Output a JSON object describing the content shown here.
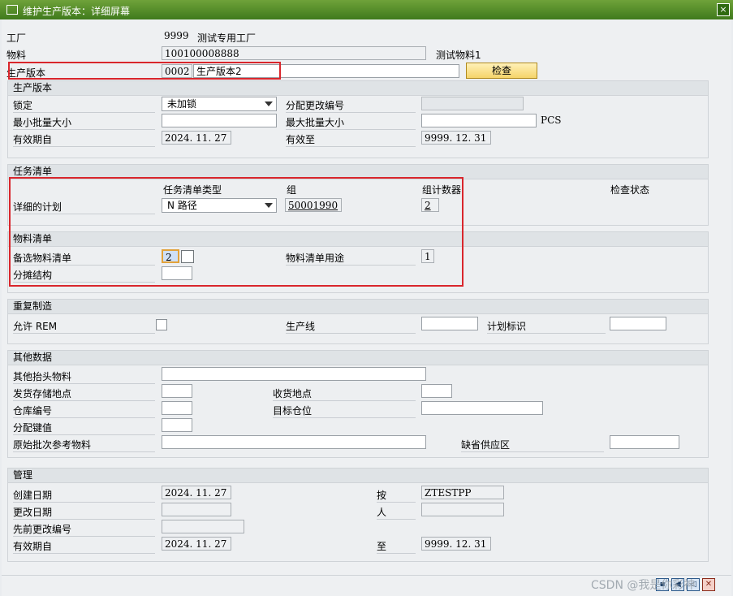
{
  "window": {
    "title": "维护生产版本：详细屏幕",
    "close_glyph": "×"
  },
  "header": {
    "plant_label": "工厂",
    "plant_value": "9999",
    "plant_desc": "测试专用工厂",
    "material_label": "物料",
    "material_value": "100100008888",
    "material_desc": "测试物料1",
    "version_label": "生产版本",
    "version_value": "0002",
    "version_desc": "生产版本2",
    "check_button": "检查"
  },
  "prod_version": {
    "title": "生产版本",
    "lock_label": "锁定",
    "lock_value": "未加锁",
    "change_no_label": "分配更改编号",
    "change_no_value": "",
    "min_lot_label": "最小批量大小",
    "min_lot_value": "",
    "max_lot_label": "最大批量大小",
    "max_lot_value": "",
    "unit": "PCS",
    "valid_from_label": "有效期自",
    "valid_from_value": "2024. 11. 27",
    "valid_to_label": "有效至",
    "valid_to_value": "9999. 12. 31"
  },
  "task_list": {
    "title": "任务清单",
    "col_type": "任务清单类型",
    "col_group": "组",
    "col_counter": "组计数器",
    "col_check": "检查状态",
    "row_label": "详细的计划",
    "type_value": "N 路径",
    "group_value": "50001990",
    "counter_value": "2"
  },
  "bom": {
    "title": "物料清单",
    "alt_label": "备选物料清单",
    "alt_value": "2",
    "usage_label": "物料清单用途",
    "usage_value": "1",
    "apportion_label": "分摊结构",
    "apportion_value": ""
  },
  "rem": {
    "title": "重复制造",
    "allow_label": "允许 REM",
    "line_label": "生产线",
    "line_value": "",
    "plan_id_label": "计划标识",
    "plan_id_value": ""
  },
  "other": {
    "title": "其他数据",
    "other_header_label": "其他抬头物料",
    "other_header_value": "",
    "issue_loc_label": "发货存储地点",
    "issue_loc_value": "",
    "receive_loc_label": "收货地点",
    "receive_loc_value": "",
    "wh_no_label": "仓库编号",
    "wh_no_value": "",
    "dest_bin_label": "目标仓位",
    "dest_bin_value": "",
    "dist_key_label": "分配键值",
    "dist_key_value": "",
    "orig_batch_label": "原始批次参考物料",
    "orig_batch_value": "",
    "default_supply_label": "缺省供应区",
    "default_supply_value": ""
  },
  "admin": {
    "title": "管理",
    "created_label": "创建日期",
    "created_value": "2024. 11. 27",
    "by_label": "按",
    "by_value": "ZTESTPP",
    "changed_label": "更改日期",
    "changed_value": "",
    "person_label": "人",
    "person_value": "",
    "prev_change_label": "先前更改编号",
    "prev_change_value": "",
    "valid_from_label": "有效期自",
    "valid_from_value": "2024. 11. 27",
    "to_label": "至",
    "to_value": "9999. 12. 31"
  },
  "footer": {
    "watermark": "CSDN @我是你彩神"
  }
}
